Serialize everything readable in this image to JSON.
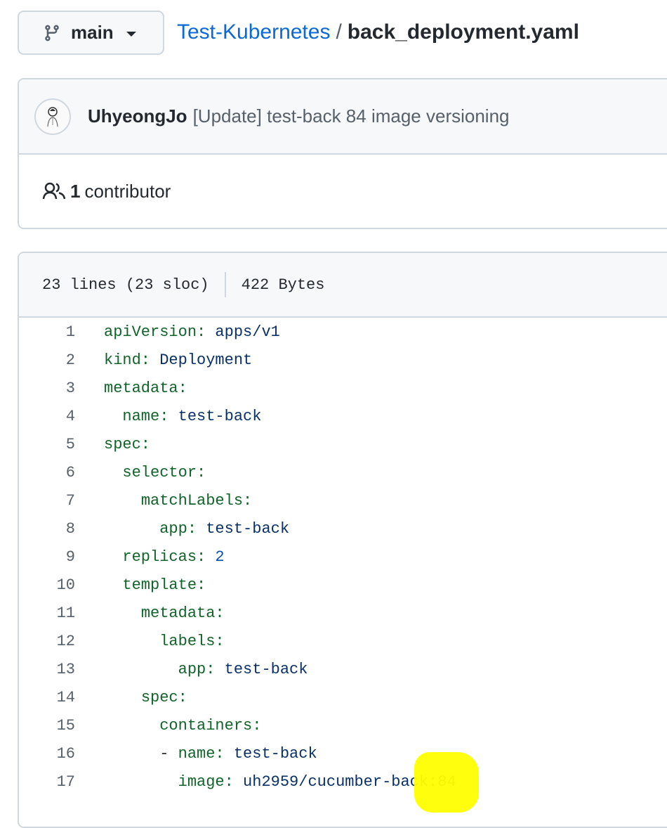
{
  "branch": {
    "icon": "git-branch-icon",
    "label": "main"
  },
  "breadcrumb": {
    "repo": "Test-Kubernetes",
    "separator": "/",
    "file": "back_deployment.yaml"
  },
  "commit": {
    "author": "UhyeongJo",
    "message": "[Update] test-back 84 image versioning"
  },
  "contributors": {
    "count": "1",
    "label": "contributor"
  },
  "file_info": {
    "lines": "23 lines (23 sloc)",
    "size": "422 Bytes"
  },
  "code_lines": [
    {
      "n": "1",
      "indent": "",
      "key": "apiVersion:",
      "value": " apps/v1"
    },
    {
      "n": "2",
      "indent": "",
      "key": "kind:",
      "value": " Deployment"
    },
    {
      "n": "3",
      "indent": "",
      "key": "metadata:",
      "value": ""
    },
    {
      "n": "4",
      "indent": "  ",
      "key": "name:",
      "value": " test-back"
    },
    {
      "n": "5",
      "indent": "",
      "key": "spec:",
      "value": ""
    },
    {
      "n": "6",
      "indent": "  ",
      "key": "selector:",
      "value": ""
    },
    {
      "n": "7",
      "indent": "    ",
      "key": "matchLabels:",
      "value": ""
    },
    {
      "n": "8",
      "indent": "      ",
      "key": "app:",
      "value": " test-back"
    },
    {
      "n": "9",
      "indent": "  ",
      "key": "replicas:",
      "value": " 2"
    },
    {
      "n": "10",
      "indent": "  ",
      "key": "template:",
      "value": ""
    },
    {
      "n": "11",
      "indent": "    ",
      "key": "metadata:",
      "value": ""
    },
    {
      "n": "12",
      "indent": "      ",
      "key": "labels:",
      "value": ""
    },
    {
      "n": "13",
      "indent": "        ",
      "key": "app:",
      "value": " test-back"
    },
    {
      "n": "14",
      "indent": "    ",
      "key": "spec:",
      "value": ""
    },
    {
      "n": "15",
      "indent": "      ",
      "key": "containers:",
      "value": ""
    },
    {
      "n": "16",
      "indent": "      ",
      "dash": "- ",
      "key": "name:",
      "value": " test-back"
    },
    {
      "n": "17",
      "indent": "        ",
      "key": "image:",
      "value": " uh2959/cucumber-back:84"
    }
  ],
  "colors": {
    "link": "#0969da",
    "yaml_key": "#116329",
    "yaml_value": "#0a3069",
    "yaml_number": "#0550ae",
    "highlight": "#ffff00"
  }
}
